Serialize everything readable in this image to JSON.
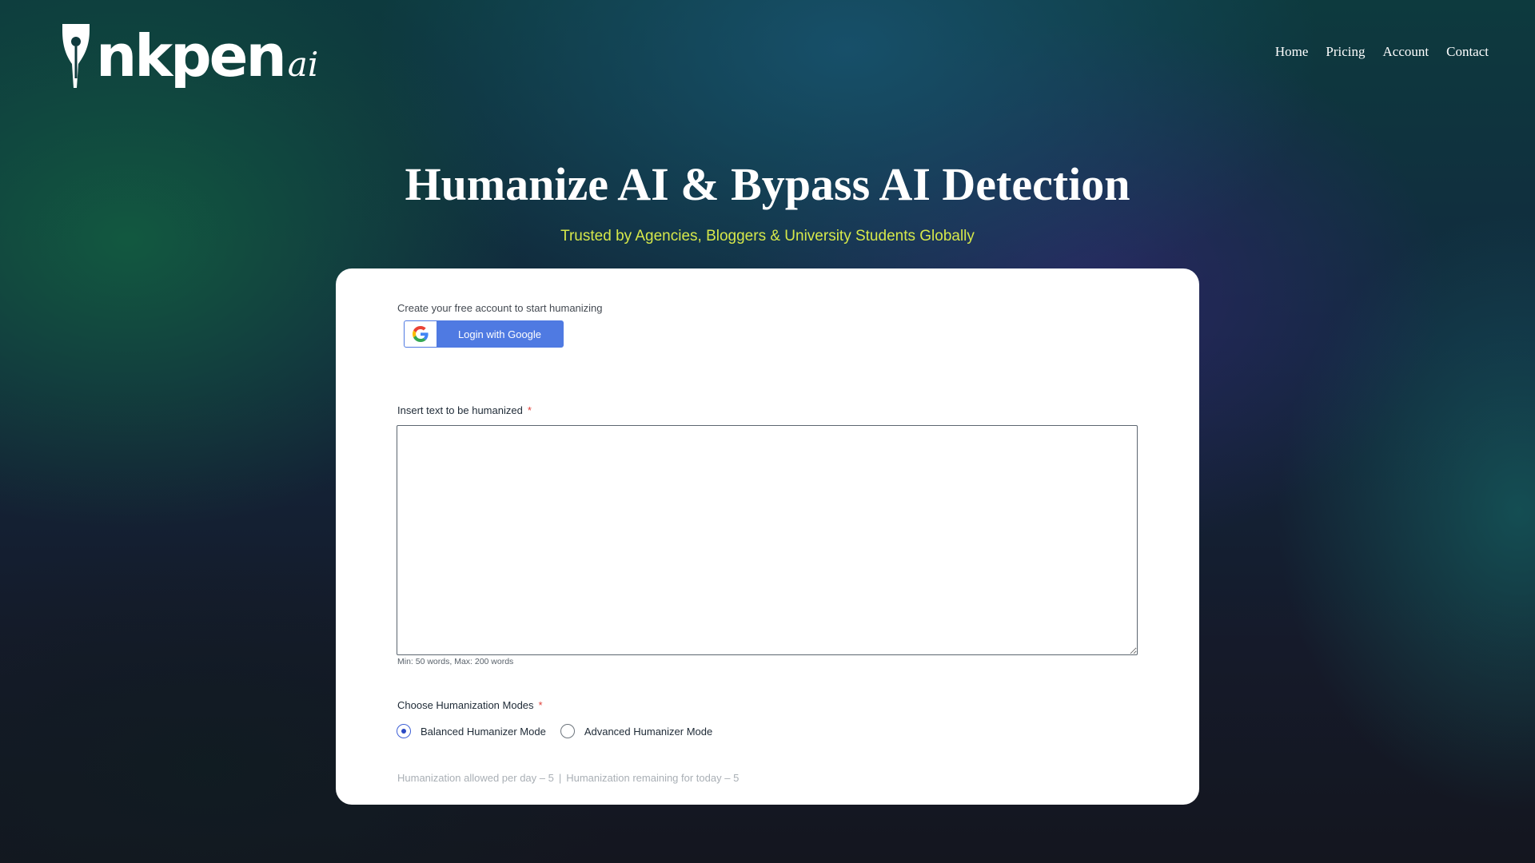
{
  "header": {
    "logo_text": "nkpen",
    "logo_suffix": "ai",
    "nav": [
      {
        "label": "Home"
      },
      {
        "label": "Pricing"
      },
      {
        "label": "Account"
      },
      {
        "label": "Contact"
      }
    ]
  },
  "hero": {
    "title": "Humanize AI & Bypass AI Detection",
    "subtitle": "Trusted by Agencies, Bloggers & University Students Globally"
  },
  "card": {
    "create_account_text": "Create your free account to start humanizing",
    "google_button_label": "Login with Google",
    "text_input": {
      "label": "Insert text to be humanized",
      "required_mark": "*",
      "value": "",
      "hint": "Min: 50 words, Max: 200 words"
    },
    "modes": {
      "label": "Choose Humanization Modes",
      "required_mark": "*",
      "options": [
        {
          "label": "Balanced Humanizer Mode",
          "selected": true
        },
        {
          "label": "Advanced Humanizer Mode",
          "selected": false
        }
      ]
    },
    "usage": {
      "allowed_text": "Humanization allowed per day – 5",
      "separator": "|",
      "remaining_text": "Humanization remaining for today – 5"
    }
  },
  "colors": {
    "subtitle": "#d6e84a",
    "google_button": "#4f7ae2",
    "required": "#e0413a",
    "radio_selected": "#2b4ac4"
  },
  "icons": {
    "logo": "pen-nib-icon",
    "google": "google-g-icon"
  }
}
